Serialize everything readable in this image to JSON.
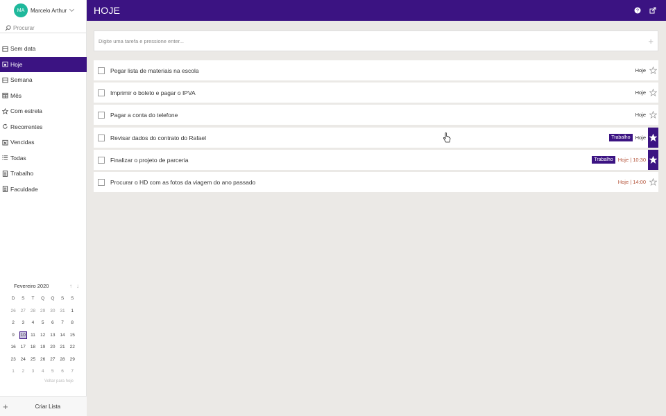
{
  "profile": {
    "initials": "MA",
    "name": "Marcelo Arthur"
  },
  "search": {
    "placeholder": "Procurar"
  },
  "nav": [
    {
      "label": "Sem data",
      "icon": "calendar-icon"
    },
    {
      "label": "Hoje",
      "icon": "calendar-day-icon",
      "active": true
    },
    {
      "label": "Semana",
      "icon": "calendar-week-icon"
    },
    {
      "label": "Mês",
      "icon": "calendar-month-icon"
    },
    {
      "label": "Com estrela",
      "icon": "star-icon"
    },
    {
      "label": "Recorrentes",
      "icon": "repeat-icon"
    },
    {
      "label": "Vencidas",
      "icon": "overdue-icon"
    },
    {
      "label": "Todas",
      "icon": "list-icon"
    },
    {
      "label": "Trabalho",
      "icon": "list-doc-icon"
    },
    {
      "label": "Faculdade",
      "icon": "list-doc-icon"
    }
  ],
  "calendar": {
    "month": "Fevereiro 2020",
    "weekdays": [
      "D",
      "S",
      "T",
      "Q",
      "Q",
      "S",
      "S"
    ],
    "weeks": [
      [
        "26",
        "27",
        "28",
        "29",
        "30",
        "31",
        "1"
      ],
      [
        "2",
        "3",
        "4",
        "5",
        "6",
        "7",
        "8"
      ],
      [
        "9",
        "10",
        "11",
        "12",
        "13",
        "14",
        "15"
      ],
      [
        "16",
        "17",
        "18",
        "19",
        "20",
        "21",
        "22"
      ],
      [
        "23",
        "24",
        "25",
        "26",
        "27",
        "28",
        "29"
      ],
      [
        "1",
        "2",
        "3",
        "4",
        "5",
        "6",
        "7"
      ]
    ],
    "selected": "10",
    "footer": "Voltar para hoje"
  },
  "create_list": {
    "label": "Criar Lista"
  },
  "header": {
    "title": "HOJE"
  },
  "add_task": {
    "placeholder": "Digite uma tarefa e pressione enter..."
  },
  "tasks": [
    {
      "text": "Pegar lista de materiais na escola",
      "tag": "",
      "due": "Hoje",
      "late": false,
      "starred": false
    },
    {
      "text": "Imprimir o boleto e pagar o IPVA",
      "tag": "",
      "due": "Hoje",
      "late": false,
      "starred": false
    },
    {
      "text": "Pagar a conta do telefone",
      "tag": "",
      "due": "Hoje",
      "late": false,
      "starred": false
    },
    {
      "text": "Revisar dados do contrato do Rafael",
      "tag": "Trabalho",
      "due": "Hoje",
      "late": false,
      "starred": true
    },
    {
      "text": "Finalizar o projeto de parceria",
      "tag": "Trabalho",
      "due": "Hoje | 10:30",
      "late": true,
      "starred": true
    },
    {
      "text": "Procurar o HD com as fotos da viagem do ano passado",
      "tag": "",
      "due": "Hoje | 14:00",
      "late": true,
      "starred": false
    }
  ],
  "colors": {
    "accent": "#3b1382",
    "late": "#b4543a",
    "avatar": "#1fb99c"
  }
}
